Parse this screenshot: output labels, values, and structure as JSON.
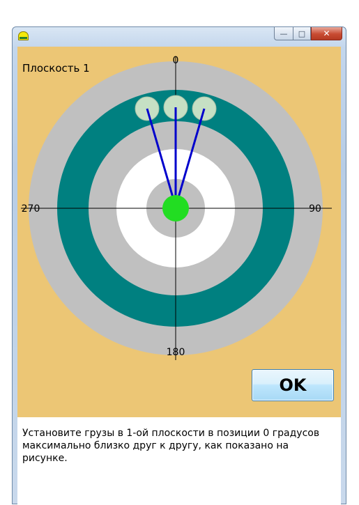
{
  "window": {
    "title": "",
    "app_icon": "app-icon",
    "buttons": {
      "minimize": "—",
      "maximize": "□",
      "close": "✕"
    }
  },
  "panel": {
    "plane_label": "Плоскость 1",
    "angle_labels": {
      "top": "0",
      "right": "90",
      "bottom": "180",
      "left": "270"
    },
    "colors": {
      "background": "#ecc675",
      "outer_ring": "#c0c0c0",
      "teal_ring": "#008080",
      "inner_white": "#ffffff",
      "hub": "#c0c0c0",
      "center": "#22dd22",
      "weights": "#c6e0c4",
      "arms": "#0000cc"
    },
    "weights_count": 3,
    "ok_label": "OK"
  },
  "message": "Установите грузы в 1-ой плоскости в позиции 0 градусов максимально близко друг к другу, как показано на рисунке."
}
